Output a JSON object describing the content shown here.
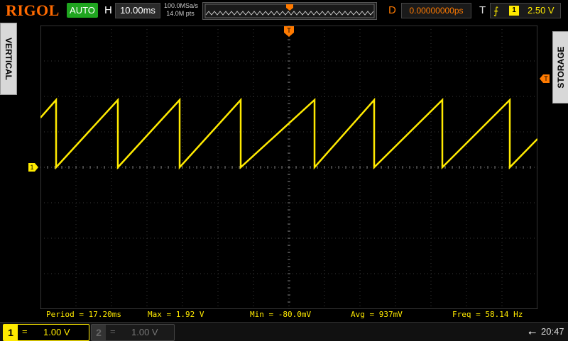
{
  "brand": "RIGOL",
  "top_bar": {
    "run_status": "AUTO",
    "h_label": "H",
    "timebase": "10.00ms",
    "sample_rate": "100.0MSa/s",
    "memory_depth": "14.0M pts",
    "d_label": "D",
    "delay": "0.00000000ps",
    "t_label": "T",
    "trigger_channel": "1",
    "trigger_level": "2.50 V"
  },
  "side_tabs": {
    "left": "VERTICAL",
    "right": "STORAGE"
  },
  "markers": {
    "trigger_position": "T",
    "trigger_level": "T",
    "ch1_ground": "1"
  },
  "measurements": [
    {
      "label": "Period = 17.20ms"
    },
    {
      "label": "Max = 1.92 V"
    },
    {
      "label": "Min = -80.0mV"
    },
    {
      "label": "Avg = 937mV"
    },
    {
      "label": "Freq = 58.14 Hz"
    }
  ],
  "channels": [
    {
      "number": "1",
      "coupling": "=",
      "scale": "1.00 V",
      "active": true,
      "color": "#ffea00"
    },
    {
      "number": "2",
      "coupling": "=",
      "scale": "1.00 V",
      "active": false,
      "color": "#666666"
    }
  ],
  "status": {
    "usb_icon": "usb-icon",
    "time": "20:47"
  },
  "colors": {
    "ch1": "#ffea00",
    "trigger": "#ff7a00",
    "run": "#1fa51f",
    "logo": "#ff6a00"
  }
}
